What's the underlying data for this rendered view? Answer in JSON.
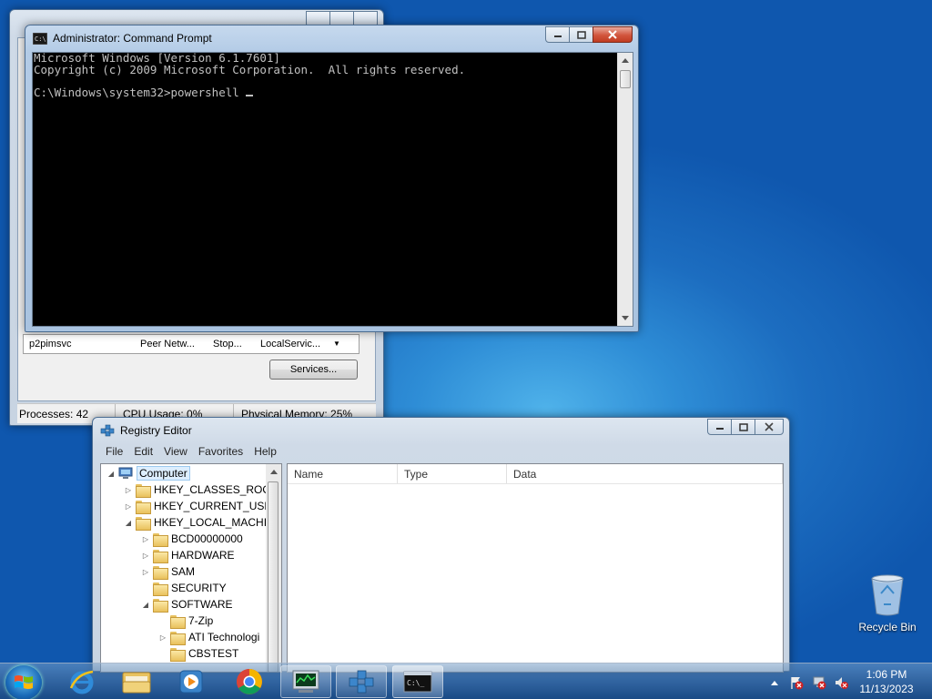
{
  "desktop": {
    "recycle_bin_label": "Recycle Bin"
  },
  "task_manager": {
    "row": {
      "name": "p2pimsvc",
      "description": "Peer Netw...",
      "status": "Stop...",
      "group": "LocalServic..."
    },
    "services_button": "Services...",
    "status": {
      "processes": "Processes: 42",
      "cpu": "CPU Usage: 0%",
      "memory": "Physical Memory: 25%"
    }
  },
  "cmd": {
    "title": "Administrator: Command Prompt",
    "lines": [
      "Microsoft Windows [Version 6.1.7601]",
      "Copyright (c) 2009 Microsoft Corporation.  All rights reserved.",
      "",
      "C:\\Windows\\system32>powershell "
    ]
  },
  "registry": {
    "title": "Registry Editor",
    "menu": [
      "File",
      "Edit",
      "View",
      "Favorites",
      "Help"
    ],
    "tree": [
      {
        "label": "Computer",
        "depth": 0,
        "expander": "◢",
        "icon": "computer"
      },
      {
        "label": "HKEY_CLASSES_ROOT",
        "depth": 1,
        "expander": "▷",
        "icon": "folder"
      },
      {
        "label": "HKEY_CURRENT_USER",
        "depth": 1,
        "expander": "▷",
        "icon": "folder"
      },
      {
        "label": "HKEY_LOCAL_MACHINE",
        "depth": 1,
        "expander": "◢",
        "icon": "folder"
      },
      {
        "label": "BCD00000000",
        "depth": 2,
        "expander": "▷",
        "icon": "folder"
      },
      {
        "label": "HARDWARE",
        "depth": 2,
        "expander": "▷",
        "icon": "folder"
      },
      {
        "label": "SAM",
        "depth": 2,
        "expander": "▷",
        "icon": "folder"
      },
      {
        "label": "SECURITY",
        "depth": 2,
        "expander": "",
        "icon": "folder"
      },
      {
        "label": "SOFTWARE",
        "depth": 2,
        "expander": "◢",
        "icon": "folder"
      },
      {
        "label": "7-Zip",
        "depth": 3,
        "expander": "",
        "icon": "folder"
      },
      {
        "label": "ATI Technologi",
        "depth": 3,
        "expander": "▷",
        "icon": "folder"
      },
      {
        "label": "CBSTEST",
        "depth": 3,
        "expander": "",
        "icon": "folder"
      }
    ],
    "columns": [
      "Name",
      "Type",
      "Data"
    ]
  },
  "taskbar": {
    "pinned": [
      "internet-explorer-icon",
      "windows-explorer-icon",
      "media-player-icon",
      "chrome-icon",
      "task-manager-icon",
      "registry-editor-icon",
      "command-prompt-icon"
    ],
    "clock": {
      "time": "1:06 PM",
      "date": "11/13/2023"
    }
  }
}
